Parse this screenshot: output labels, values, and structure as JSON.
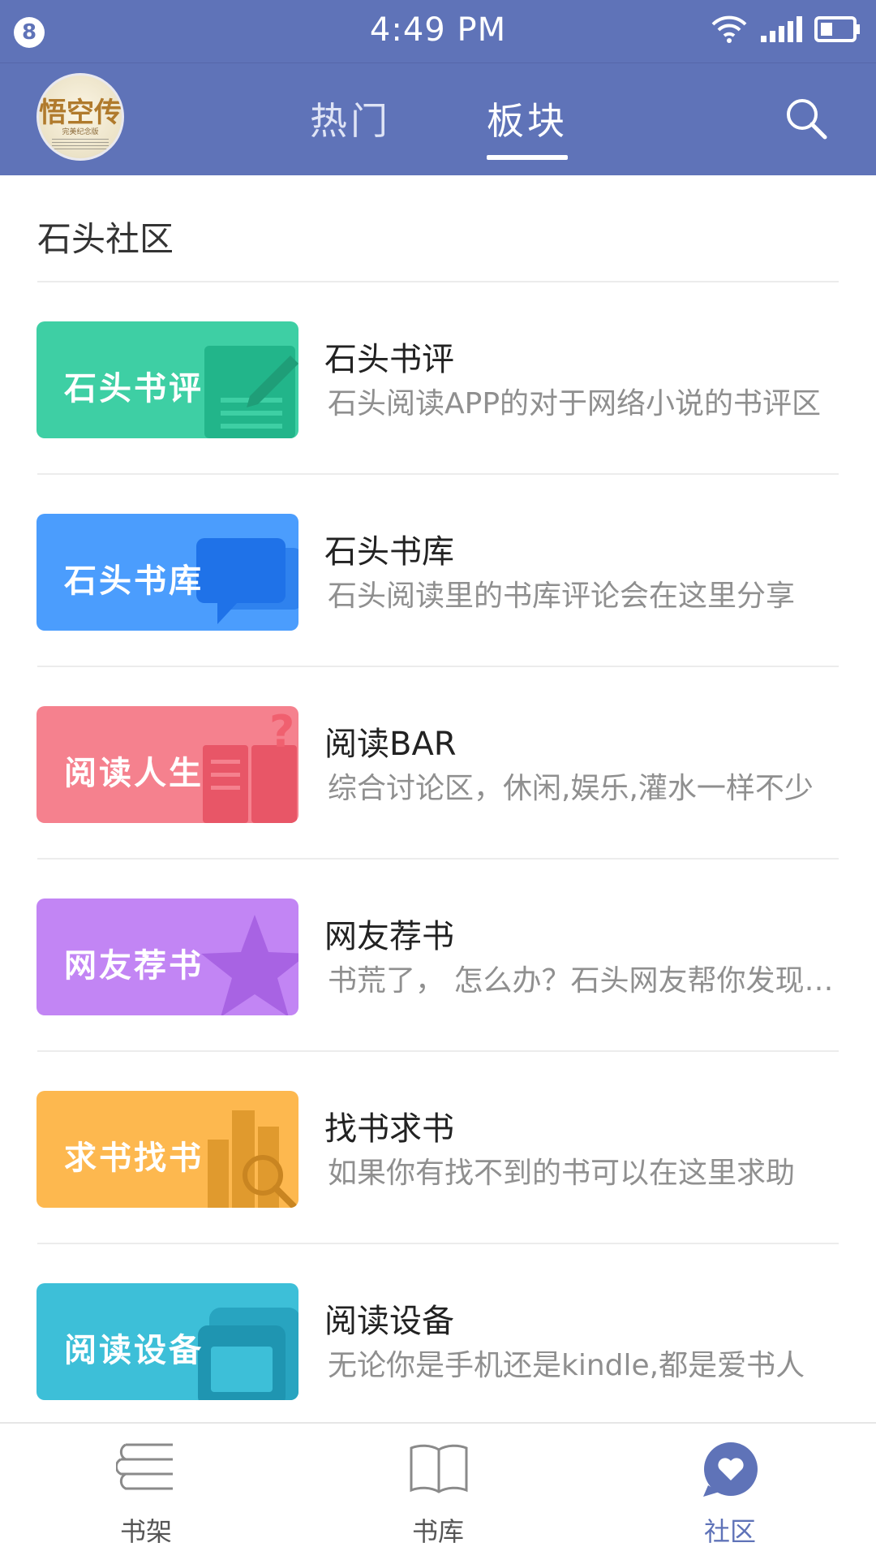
{
  "status_bar": {
    "notification_count": "8",
    "time": "4:49 PM",
    "icons": [
      "wifi-icon",
      "signal-icon",
      "battery-icon"
    ]
  },
  "header": {
    "tabs": [
      {
        "label": "热门",
        "active": false
      },
      {
        "label": "板块",
        "active": true
      }
    ],
    "avatar_title": "悟空传",
    "avatar_subtitle": "完美纪念版",
    "search_icon": "search-icon"
  },
  "main": {
    "section_title": "石头社区",
    "boards": [
      {
        "banner": "石头书评",
        "name": "石头书评",
        "desc": "石头阅读APP的对于网络小说的书评区",
        "color": "#3ecfa4",
        "icon": "edit-document-icon"
      },
      {
        "banner": "石头书库",
        "name": "石头书库",
        "desc": "石头阅读里的书库评论会在这里分享",
        "color": "#4b9dfd",
        "icon": "chat-bubble-icon"
      },
      {
        "banner": "阅读人生",
        "name": "阅读BAR",
        "desc": "综合讨论区，休闲,娱乐,灌水一样不少",
        "color": "#f5818e",
        "icon": "open-book-icon"
      },
      {
        "banner": "网友荐书",
        "name": "网友荐书",
        "desc": "书荒了， 怎么办？石头网友帮你发现好书",
        "color": "#c285f4",
        "icon": "star-icon"
      },
      {
        "banner": "求书找书",
        "name": "找书求书",
        "desc": "如果你有找不到的书可以在这里求助",
        "color": "#fdb84f",
        "icon": "book-search-icon"
      },
      {
        "banner": "阅读设备",
        "name": "阅读设备",
        "desc": "无论你是手机还是kindle,都是爱书人",
        "color": "#3dbfd8",
        "icon": "device-icon"
      }
    ]
  },
  "bottom_nav": {
    "items": [
      {
        "label": "书架",
        "icon": "bookshelf-icon",
        "active": false
      },
      {
        "label": "书库",
        "icon": "book-icon",
        "active": false
      },
      {
        "label": "社区",
        "icon": "community-icon",
        "active": true
      }
    ]
  },
  "colors": {
    "brand": "#5f73b8",
    "active_nav": "#5f73b8",
    "text_primary": "#222222",
    "text_secondary": "#8f8f8f"
  }
}
